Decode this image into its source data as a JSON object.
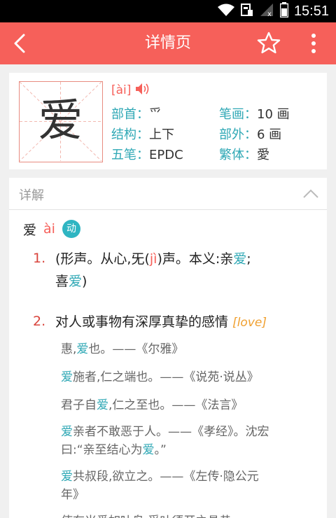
{
  "status_bar": {
    "time": "15:51"
  },
  "app_bar": {
    "title": "详情页"
  },
  "char_card": {
    "character": "爱",
    "pinyin": "[ài]",
    "radical": {
      "label": "部首",
      "value": "爫"
    },
    "strokes": {
      "label": "笔画",
      "value": "10 画"
    },
    "structure": {
      "label": "结构",
      "value": "上下"
    },
    "outer_strokes": {
      "label": "部外",
      "value": "6 画"
    },
    "wubi": {
      "label": "五笔",
      "value": "EPDC"
    },
    "traditional": {
      "label": "繁体",
      "value": "愛"
    },
    "separator": "："
  },
  "detail": {
    "title": "详解",
    "entry": {
      "char": "爱",
      "pinyin": "ài",
      "pos": "动"
    },
    "definitions": [
      {
        "num": "1.",
        "line1_a": "(形声。从心,旡(",
        "line1_b": "jì",
        "line1_c": ")声。本义:亲",
        "line1_d": "爱",
        "line1_e": ";",
        "line2_a": "喜",
        "line2_b": "爱",
        "line2_c": ")"
      },
      {
        "num": "2.",
        "text": "对人或事物有深厚真挚的感情",
        "english": "[love]"
      }
    ],
    "examples": [
      {
        "pre": "惠,",
        "hl": "爱",
        "post": "也。——《尔雅》"
      },
      {
        "pre": "",
        "hl": "爱",
        "post": "施者,仁之端也。——《说苑·说丛》"
      },
      {
        "pre": "君子自",
        "hl": "爱",
        "post": ",仁之至也。——《法言》"
      },
      {
        "pre": "",
        "hl": "爱",
        "post": "亲者不敢恶于人。——《孝经》。沈宏",
        "line2_a": "曰:“亲至结心为",
        "line2_b": "爱",
        "line2_c": "。”"
      },
      {
        "pre": "",
        "hl": "爱",
        "post": "共叔段,欲立之。——《左传·隐公元",
        "line2_a": "年》"
      }
    ],
    "partial_last_line": "使有米爱如吐鸟 受叶须开之具恭"
  },
  "colors": {
    "accent": "#f6605a",
    "teal": "#2fa8b5",
    "english": "#f0a030"
  }
}
